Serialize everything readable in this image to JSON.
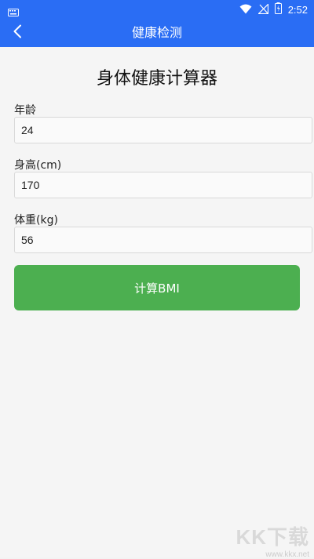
{
  "status_bar": {
    "time": "2:52",
    "icons": [
      "keyboard-icon",
      "wifi-icon",
      "no-signal-icon",
      "battery-icon"
    ]
  },
  "app_bar": {
    "title": "健康检测",
    "back_icon": "chevron-left-icon"
  },
  "main": {
    "title": "身体健康计算器",
    "fields": [
      {
        "label": "年龄",
        "value": "24"
      },
      {
        "label": "身高(cm)",
        "value": "170"
      },
      {
        "label": "体重(kg)",
        "value": "56"
      }
    ],
    "calculate_label": "计算BMI"
  },
  "watermark": {
    "main": "KK下载",
    "sub": "www.kkx.net"
  },
  "colors": {
    "header": "#2a6df4",
    "button": "#4caf50",
    "background": "#f5f5f5"
  }
}
